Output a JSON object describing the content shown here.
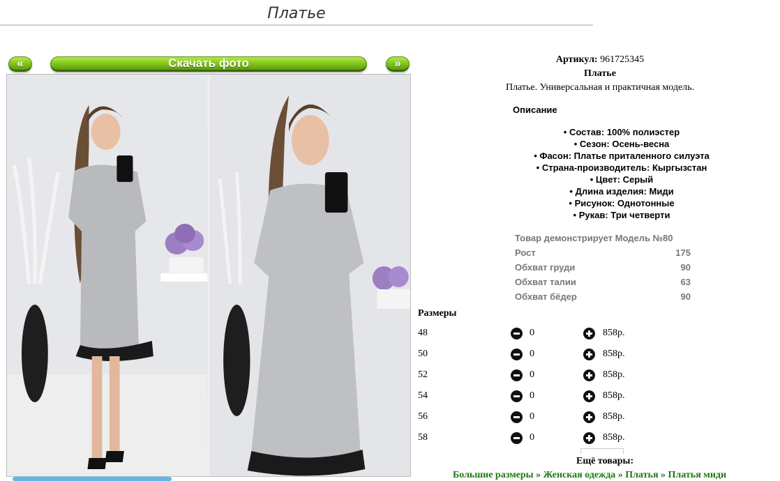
{
  "page": {
    "title": "Платье"
  },
  "nav": {
    "prev": "«",
    "next": "»",
    "download": "Скачать фото"
  },
  "product": {
    "sku_label": "Артикул:",
    "sku": "961725345",
    "name": "Платье",
    "short": "Платье. Универсальная и практичная модель."
  },
  "description": {
    "heading": "Описание",
    "features": [
      "Состав: 100% полиэстер",
      "Сезон: Осень-весна",
      "Фасон: Платье приталенного силуэта",
      "Страна-производитель: Кыргызстан",
      "Цвет: Серый",
      "Длина изделия: Миди",
      "Рисунок: Однотонные",
      "Рукав: Три четверти"
    ]
  },
  "model": {
    "rows": [
      {
        "label": "Товар демонстрирует Модель №80",
        "value": ""
      },
      {
        "label": "Рост",
        "value": "175"
      },
      {
        "label": "Обхват груди",
        "value": "90"
      },
      {
        "label": "Обхват талии",
        "value": "63"
      },
      {
        "label": "Обхват бёдер",
        "value": "90"
      }
    ]
  },
  "sizes": {
    "heading": "Размеры",
    "rows": [
      {
        "size": "48",
        "qty": "0",
        "price": "858р."
      },
      {
        "size": "50",
        "qty": "0",
        "price": "858р."
      },
      {
        "size": "52",
        "qty": "0",
        "price": "858р."
      },
      {
        "size": "54",
        "qty": "0",
        "price": "858р."
      },
      {
        "size": "56",
        "qty": "0",
        "price": "858р."
      },
      {
        "size": "58",
        "qty": "0",
        "price": "858р."
      }
    ]
  },
  "more": {
    "heading": "Ещё товары:",
    "breadcrumbs": [
      "Большие размеры",
      "Женская одежда",
      "Платья",
      "Платья миди"
    ],
    "separator": "»"
  },
  "colors": {
    "accent_green": "#1a7a12",
    "button_green": "#86c91f"
  }
}
